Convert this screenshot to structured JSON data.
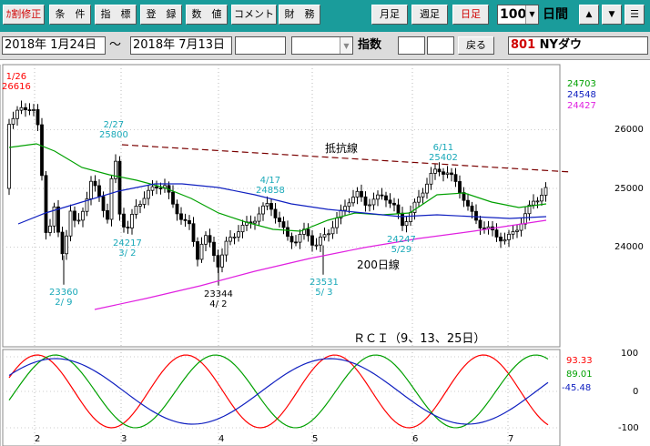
{
  "toolbar": {
    "buttons": [
      "ｶ割修正",
      "条　件",
      "指　標",
      "登　録",
      "数　値",
      "コメント",
      "財　務",
      "月足",
      "週足",
      "日足"
    ],
    "period_count": "100",
    "period_label": "日間",
    "nav": [
      "▲",
      "▼",
      "☰"
    ]
  },
  "range": {
    "start": "2018年 1月24日",
    "sep": "～",
    "end": "2018年 7月13日",
    "index_label": "指数",
    "back_label": "戻る",
    "code": "801",
    "name": "NYダウ"
  },
  "chart_data": {
    "type": "candlestick",
    "title": "",
    "price_axis": {
      "ticks": [
        24000,
        25000,
        26000
      ],
      "ylim": [
        23100,
        27000
      ]
    },
    "x_month_labels": [
      "2",
      "3",
      "4",
      "5",
      "6",
      "7"
    ],
    "legend_values": [
      {
        "value": "24703",
        "color": "#00a000"
      },
      {
        "value": "24548",
        "color": "#1020c0"
      },
      {
        "value": "24427",
        "color": "#e020e0"
      }
    ],
    "annotations": [
      {
        "lines": [
          "1/26",
          "26616"
        ],
        "color": "#ff0000"
      },
      {
        "lines": [
          "2/27",
          "25800"
        ],
        "color": "#18a8b8"
      },
      {
        "lines": [
          "4/17",
          "24858"
        ],
        "color": "#18a8b8"
      },
      {
        "lines": [
          "6/11",
          "25402"
        ],
        "color": "#18a8b8"
      },
      {
        "lines": [
          "24217",
          " 3/ 2"
        ],
        "color": "#18a8b8"
      },
      {
        "lines": [
          "23360",
          " 2/ 9"
        ],
        "color": "#18a8b8"
      },
      {
        "lines": [
          "23344",
          " 4/ 2"
        ],
        "color": "#000000"
      },
      {
        "lines": [
          "23531",
          " 5/ 3"
        ],
        "color": "#18a8b8"
      },
      {
        "lines": [
          "24247",
          " 5/29"
        ],
        "color": "#18a8b8"
      }
    ],
    "resistance_label": "抵抗線",
    "ma200_label": "200日線",
    "rci": {
      "title": "ＲＣＩ（9、13、25日）",
      "axis_ticks": [
        "100",
        "0",
        "-100"
      ],
      "values": [
        {
          "value": "93.33",
          "color": "#ff0000"
        },
        {
          "value": "89.01",
          "color": "#00a000"
        },
        {
          "value": "-45.48",
          "color": "#1020c0"
        }
      ]
    }
  }
}
